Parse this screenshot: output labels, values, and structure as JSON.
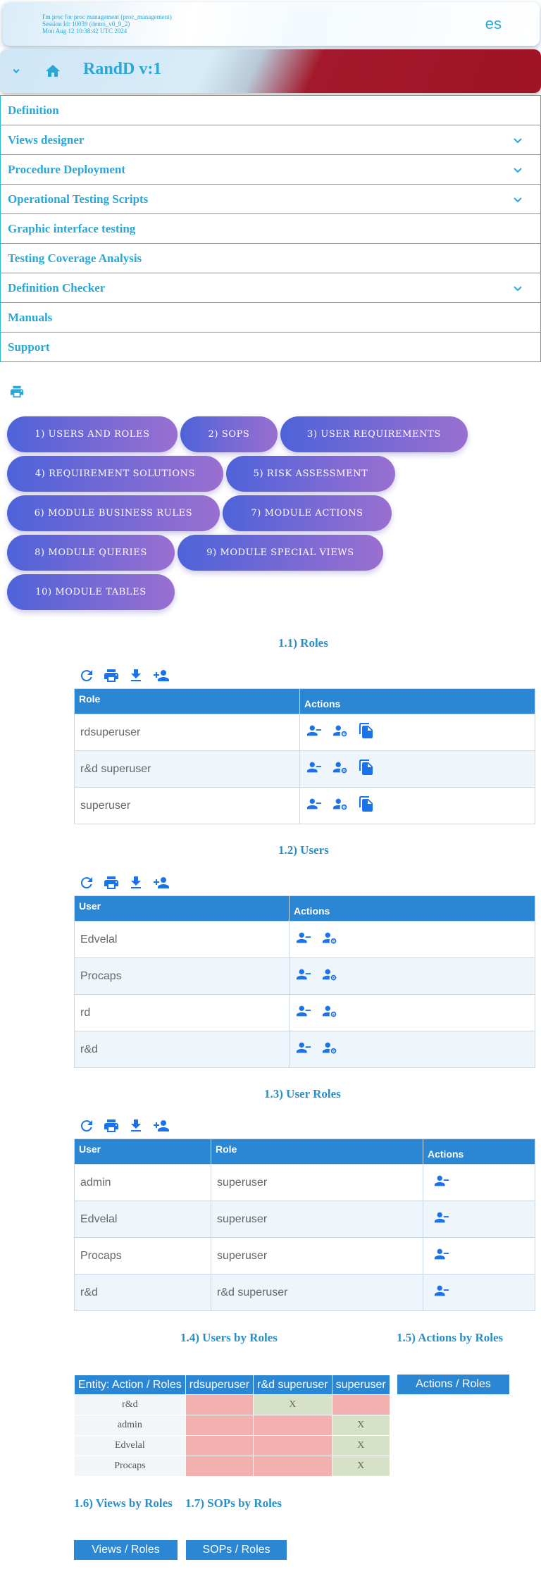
{
  "session": {
    "line1": "I'm proc for proc management (proc_management)",
    "line2": "Session Id: 10039 (demo_v0_9_2)",
    "line3": "Mon Aug 12 10:38:42 UTC 2024",
    "language": "es"
  },
  "appbar": {
    "title": "RandD v:1",
    "menu_icon": "chevron-down-icon",
    "home_icon": "home-icon"
  },
  "menu": [
    {
      "label": "Definition"
    },
    {
      "label": "Views designer"
    },
    {
      "label": "Procedure Deployment"
    },
    {
      "label": "Operational Testing Scripts"
    },
    {
      "label": "Graphic interface testing"
    },
    {
      "label": "Testing Coverage Analysis"
    },
    {
      "label": "Definition Checker"
    },
    {
      "label": "Manuals"
    },
    {
      "label": "Support"
    }
  ],
  "sections": [
    "1) USERS AND ROLES",
    "2) SOPS",
    "3) USER REQUIREMENTS",
    "4) REQUIREMENT SOLUTIONS",
    "5) RISK ASSESSMENT",
    "6) MODULE BUSINESS RULES",
    "7) MODULE ACTIONS",
    "8) MODULE QUERIES",
    "9) MODULE SPECIAL VIEWS",
    "10) MODULE TABLES"
  ],
  "roles": {
    "title": "1.1) Roles",
    "headers": {
      "role": "Role",
      "actions": "Actions"
    },
    "rows": [
      "rdsuperuser",
      "r&d superuser",
      "superuser"
    ]
  },
  "users": {
    "title": "1.2) Users",
    "headers": {
      "user": "User",
      "actions": "Actions"
    },
    "rows": [
      "Edvelal",
      "Procaps",
      "rd",
      "r&d"
    ]
  },
  "user_roles": {
    "title": "1.3) User Roles",
    "headers": {
      "user": "User",
      "role": "Role",
      "actions": "Actions"
    },
    "rows": [
      {
        "user": "admin",
        "role": "superuser"
      },
      {
        "user": "Edvelal",
        "role": "superuser"
      },
      {
        "user": "Procaps",
        "role": "superuser"
      },
      {
        "user": "r&d",
        "role": "r&d superuser"
      }
    ]
  },
  "users_by_roles": {
    "title": "1.4) Users by Roles",
    "corner": "Entity: Action / Roles",
    "roles": [
      "rdsuperuser",
      "r&d superuser",
      "superuser"
    ],
    "rows": [
      {
        "entity": "r&d",
        "cells": [
          "",
          "X",
          ""
        ]
      },
      {
        "entity": "admin",
        "cells": [
          "",
          "",
          "X"
        ]
      },
      {
        "entity": "Edvelal",
        "cells": [
          "",
          "",
          "X"
        ]
      },
      {
        "entity": "Procaps",
        "cells": [
          "",
          "",
          "X"
        ]
      }
    ]
  },
  "actions_by_roles": {
    "title": "1.5) Actions by Roles",
    "button": "Actions / Roles"
  },
  "views_by_roles": {
    "title": "1.6) Views by Roles",
    "button": "Views / Roles"
  },
  "sops_by_roles": {
    "title": "1.7) SOPs by Roles",
    "button": "SOPs / Roles"
  },
  "colors": {
    "accent": "#2aa7d7",
    "header": "#2b87d4",
    "icon": "#1a73e8",
    "denied": "#f2b0ae",
    "granted": "#d7e1c8"
  }
}
